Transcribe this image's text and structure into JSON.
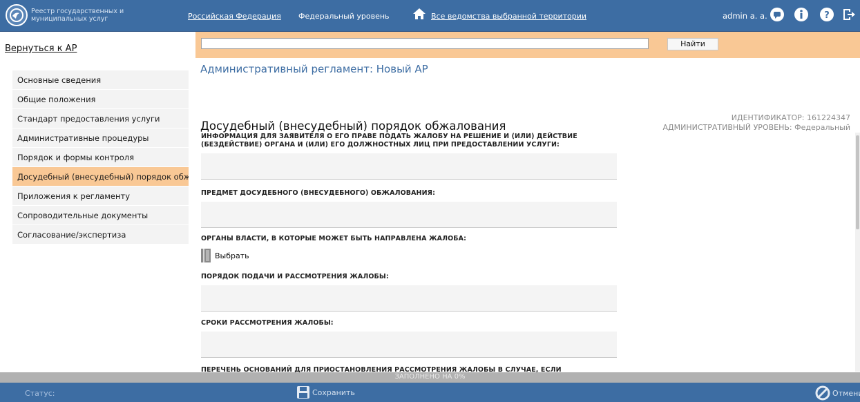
{
  "header": {
    "logo_text": "Реестр государственных и муниципальных услуг",
    "territory": "Российская Федерация",
    "level": "Федеральный уровень",
    "departments": "Все ведомства выбранной территории",
    "user": "admin a. a.",
    "icons": [
      "home-icon",
      "chat-icon",
      "info-icon",
      "help-icon",
      "logout-icon"
    ]
  },
  "sidebar": {
    "back_link": "Вернуться к АР",
    "items": [
      {
        "label": "Основные сведения"
      },
      {
        "label": "Общие положения"
      },
      {
        "label": "Стандарт предоставления услуги"
      },
      {
        "label": "Административные процедуры"
      },
      {
        "label": "Порядок и формы контроля"
      },
      {
        "label": "Досудебный (внесудебный) порядок обжалования",
        "active": true
      },
      {
        "label": "Приложения к регламенту"
      },
      {
        "label": "Сопроводительные документы"
      },
      {
        "label": "Согласование/экспертиза"
      }
    ]
  },
  "search": {
    "value": "",
    "button": "Найти"
  },
  "main": {
    "regulation_title": "Административный регламент: Новый АР",
    "section_title": "Досудебный (внесудебный) порядок обжалования",
    "identifier": "ИДЕНТИФИКАТОР: 161224347",
    "admin_level": "АДМИНИСТРАТИВНЫЙ УРОВЕНЬ: Федеральный",
    "fields": {
      "f1": "ИНФОРМАЦИЯ ДЛЯ ЗАЯВИТЕЛЯ О ЕГО ПРАВЕ ПОДАТЬ ЖАЛОБУ НА РЕШЕНИЕ И (ИЛИ) ДЕЙСТВИЕ (БЕЗДЕЙСТВИЕ) ОРГАНА И (ИЛИ) ЕГО ДОЛЖНОСТНЫХ ЛИЦ ПРИ ПРЕДОСТАВЛЕНИИ УСЛУГИ:",
      "f2": "ПРЕДМЕТ ДОСУДЕБНОГО (ВНЕСУДЕБНОГО) ОБЖАЛОВАНИЯ:",
      "f3": "ОРГАНЫ ВЛАСТИ, В КОТОРЫЕ МОЖЕТ БЫТЬ НАПРАВЛЕНА ЖАЛОБА:",
      "f3_select": "Выбрать",
      "f4": "ПОРЯДОК ПОДАЧИ И РАССМОТРЕНИЯ ЖАЛОБЫ:",
      "f5": "СРОКИ РАССМОТРЕНИЯ ЖАЛОБЫ:",
      "f6": "ПЕРЕЧЕНЬ ОСНОВАНИЙ ДЛЯ ПРИОСТАНОВЛЕНИЯ РАССМОТРЕНИЯ ЖАЛОБЫ В СЛУЧАЕ, ЕСЛИ ВОЗМОЖНОСТЬ"
    }
  },
  "footer": {
    "progress_text": "ЗАПОЛНЕНО НА 0%",
    "progress_fraction": 0,
    "status_label": "Статус:",
    "save": "Сохранить",
    "cancel": "Отменить"
  }
}
